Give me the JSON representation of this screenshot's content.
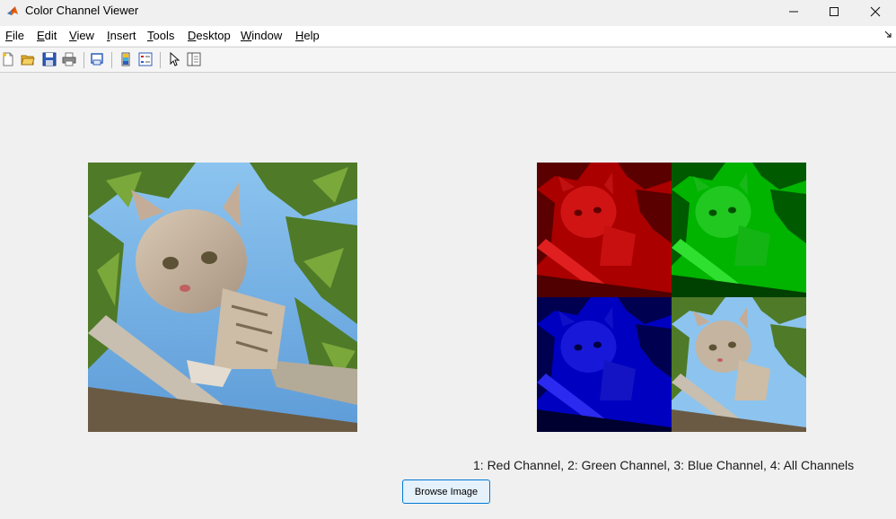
{
  "window": {
    "title": "Color Channel Viewer",
    "controls": {
      "minimize": "—",
      "maximize": "☐",
      "close": "✕"
    }
  },
  "menubar": {
    "items": [
      {
        "label": "File",
        "mnemonic": "F",
        "rest": "ile"
      },
      {
        "label": "Edit",
        "mnemonic": "E",
        "rest": "dit"
      },
      {
        "label": "View",
        "mnemonic": "V",
        "rest": "iew"
      },
      {
        "label": "Insert",
        "mnemonic": "I",
        "rest": "nsert"
      },
      {
        "label": "Tools",
        "mnemonic": "T",
        "rest": "ools"
      },
      {
        "label": "Desktop",
        "mnemonic": "D",
        "rest": "esktop"
      },
      {
        "label": "Window",
        "mnemonic": "W",
        "rest": "indow"
      },
      {
        "label": "Help",
        "mnemonic": "H",
        "rest": "elp"
      }
    ],
    "dock_icon": "dock-arrow-icon"
  },
  "toolbar": {
    "icons": [
      "new-figure-icon",
      "open-file-icon",
      "save-icon",
      "print-icon",
      "print-preview-icon",
      "colorbar-icon",
      "legend-icon",
      "select-pointer-icon",
      "property-inspector-icon"
    ]
  },
  "figure": {
    "original_image": "cat-in-tree-photo",
    "channels": [
      "red-channel",
      "green-channel",
      "blue-channel",
      "all-channels"
    ],
    "channel_colors": {
      "red": "#cc0000",
      "green": "#00b000",
      "blue": "#0000c8"
    }
  },
  "caption": "1: Red Channel, 2: Green Channel, 3: Blue Channel, 4: All Channels",
  "browse_button": {
    "label": "Browse Image"
  }
}
